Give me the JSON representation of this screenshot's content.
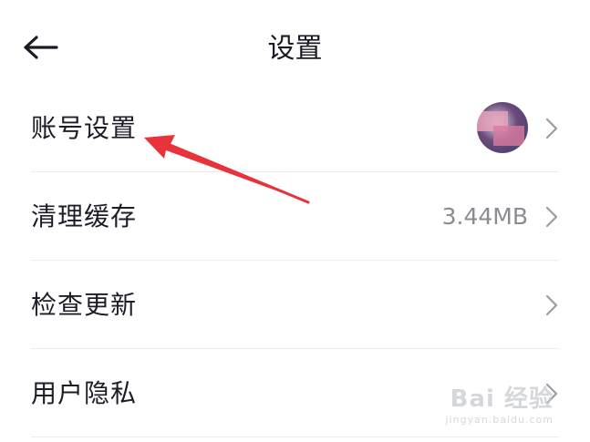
{
  "header": {
    "title": "设置",
    "back_icon": "arrow-left-icon"
  },
  "settings": {
    "items": [
      {
        "label": "账号设置",
        "value": "",
        "trailing": "avatar"
      },
      {
        "label": "清理缓存",
        "value": "3.44MB",
        "trailing": "chevron-right-icon"
      },
      {
        "label": "检查更新",
        "value": "",
        "trailing": "chevron-right-icon"
      },
      {
        "label": "用户隐私",
        "value": "",
        "trailing": "chevron-right-icon"
      }
    ]
  },
  "annotation": {
    "color": "#e8333a"
  },
  "watermark": {
    "main": "Bai 经验",
    "sub": "jingyan.baidu.com"
  },
  "colors": {
    "text": "#1d1d28",
    "secondary": "#8a8c94",
    "divider": "#ececf0",
    "chevron": "#9a9ca4"
  }
}
